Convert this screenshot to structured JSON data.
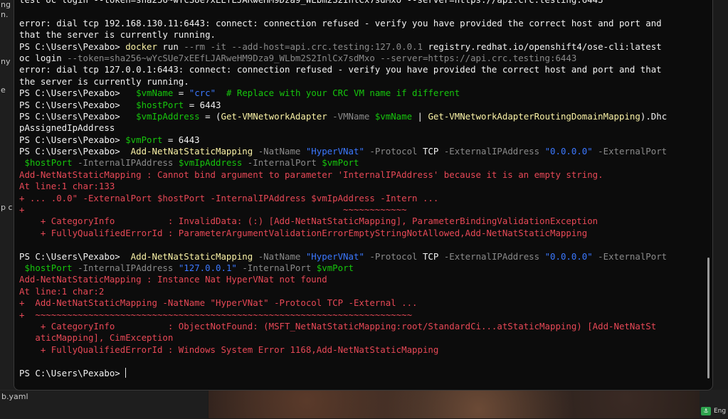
{
  "background": {
    "left_fragments": [
      "ng",
      "n.",
      "ny",
      "e",
      "p c"
    ],
    "bottom_left_text": "b.yaml"
  },
  "tray": {
    "app_icon": "docker-icon",
    "language": "Eng"
  },
  "terminal": {
    "lines": [
      [
        {
          "t": "test oc login --token=sha256~wYcSUe7xEEfLJARweHM9Dza9_WLbm2S2InlCx7sdMxo --server=https://api.crc.testing:6443",
          "c": "wh"
        }
      ],
      [],
      [
        {
          "t": "error: dial tcp 192.168.130.11:6443: connect: connection refused - verify you have provided the correct host and port and",
          "c": "wh"
        }
      ],
      [
        {
          "t": "that the server is currently running.",
          "c": "wh"
        }
      ],
      [
        {
          "t": "PS C:\\Users\\Pexabo> ",
          "c": "wh"
        },
        {
          "t": "docker",
          "c": "y"
        },
        {
          "t": " run ",
          "c": "wh"
        },
        {
          "t": "--rm -it --add-host=api.crc.testing:127.0.0.1",
          "c": "gy"
        },
        {
          "t": " registry.redhat.io/openshift4/ose-cli:latest",
          "c": "wh"
        }
      ],
      [
        {
          "t": "oc login ",
          "c": "wh"
        },
        {
          "t": "--token=sha256~wYcSUe7xEEfLJARweHM9Dza9_WLbm2S2InlCx7sdMxo --server=https://api.crc.testing:6443",
          "c": "gy"
        }
      ],
      [
        {
          "t": "error: dial tcp 127.0.0.1:6443: connect: connection refused - verify you have provided the correct host and port and that",
          "c": "wh"
        }
      ],
      [
        {
          "t": "the server is currently running.",
          "c": "wh"
        }
      ],
      [
        {
          "t": "PS C:\\Users\\Pexabo>   ",
          "c": "wh"
        },
        {
          "t": "$vmName",
          "c": "gr"
        },
        {
          "t": " = ",
          "c": "wh"
        },
        {
          "t": "\"crc\"",
          "c": "bl"
        },
        {
          "t": "  # Replace with your CRC VM name if different",
          "c": "gr"
        }
      ],
      [
        {
          "t": "PS C:\\Users\\Pexabo>   ",
          "c": "wh"
        },
        {
          "t": "$hostPort",
          "c": "gr"
        },
        {
          "t": " = 6443",
          "c": "wh"
        }
      ],
      [
        {
          "t": "PS C:\\Users\\Pexabo>   ",
          "c": "wh"
        },
        {
          "t": "$vmIpAddress",
          "c": "gr"
        },
        {
          "t": " = (",
          "c": "wh"
        },
        {
          "t": "Get-VMNetworkAdapter",
          "c": "y"
        },
        {
          "t": " -VMName ",
          "c": "gy"
        },
        {
          "t": "$vmName",
          "c": "gr"
        },
        {
          "t": " | ",
          "c": "wh"
        },
        {
          "t": "Get-VMNetworkAdapterRoutingDomainMapping",
          "c": "y"
        },
        {
          "t": ").Dhc",
          "c": "wh"
        }
      ],
      [
        {
          "t": "pAssignedIpAddress",
          "c": "wh"
        }
      ],
      [
        {
          "t": "PS C:\\Users\\Pexabo> ",
          "c": "wh"
        },
        {
          "t": "$vmPort",
          "c": "gr"
        },
        {
          "t": " = 6443",
          "c": "wh"
        }
      ],
      [
        {
          "t": "PS C:\\Users\\Pexabo>  ",
          "c": "wh"
        },
        {
          "t": "Add-NetNatStaticMapping",
          "c": "y"
        },
        {
          "t": " -NatName ",
          "c": "gy"
        },
        {
          "t": "\"HyperVNat\"",
          "c": "bl"
        },
        {
          "t": " -Protocol ",
          "c": "gy"
        },
        {
          "t": "TCP",
          "c": "wh"
        },
        {
          "t": " -ExternalIPAddress ",
          "c": "gy"
        },
        {
          "t": "\"0.0.0.0\"",
          "c": "bl"
        },
        {
          "t": " -ExternalPort",
          "c": "gy"
        }
      ],
      [
        {
          "t": " $hostPort",
          "c": "gr"
        },
        {
          "t": " -InternalIPAddress ",
          "c": "gy"
        },
        {
          "t": "$vmIpAddress",
          "c": "gr"
        },
        {
          "t": " -InternalPort ",
          "c": "gy"
        },
        {
          "t": "$vmPort",
          "c": "gr"
        }
      ],
      [
        {
          "t": "Add-NetNatStaticMapping : Cannot bind argument to parameter 'InternalIPAddress' because it is an empty string.",
          "c": "rd"
        }
      ],
      [
        {
          "t": "At line:1 char:133",
          "c": "rd"
        }
      ],
      [
        {
          "t": "+ ... .0.0\" -ExternalPort $hostPort -InternalIPAddress $vmIpAddress -Intern ...",
          "c": "rd"
        }
      ],
      [
        {
          "t": "+                                                            ~~~~~~~~~~~~",
          "c": "rd"
        }
      ],
      [
        {
          "t": "    + CategoryInfo          : InvalidData: (:) [Add-NetNatStaticMapping], ParameterBindingValidationException",
          "c": "rd"
        }
      ],
      [
        {
          "t": "    + FullyQualifiedErrorId : ParameterArgumentValidationErrorEmptyStringNotAllowed,Add-NetNatStaticMapping",
          "c": "rd"
        }
      ],
      [],
      [
        {
          "t": "PS C:\\Users\\Pexabo>  ",
          "c": "wh"
        },
        {
          "t": "Add-NetNatStaticMapping",
          "c": "y"
        },
        {
          "t": " -NatName ",
          "c": "gy"
        },
        {
          "t": "\"HyperVNat\"",
          "c": "bl"
        },
        {
          "t": " -Protocol ",
          "c": "gy"
        },
        {
          "t": "TCP",
          "c": "wh"
        },
        {
          "t": " -ExternalIPAddress ",
          "c": "gy"
        },
        {
          "t": "\"0.0.0.0\"",
          "c": "bl"
        },
        {
          "t": " -ExternalPort",
          "c": "gy"
        }
      ],
      [
        {
          "t": " $hostPort",
          "c": "gr"
        },
        {
          "t": " -InternalIPAddress ",
          "c": "gy"
        },
        {
          "t": "\"127.0.0.1\"",
          "c": "bl"
        },
        {
          "t": " -InternalPort ",
          "c": "gy"
        },
        {
          "t": "$vmPort",
          "c": "gr"
        }
      ],
      [
        {
          "t": "Add-NetNatStaticMapping : Instance Nat HyperVNat not found",
          "c": "rd"
        }
      ],
      [
        {
          "t": "At line:1 char:2",
          "c": "rd"
        }
      ],
      [
        {
          "t": "+  Add-NetNatStaticMapping -NatName \"HyperVNat\" -Protocol TCP -External ...",
          "c": "rd"
        }
      ],
      [
        {
          "t": "+  ~~~~~~~~~~~~~~~~~~~~~~~~~~~~~~~~~~~~~~~~~~~~~~~~~~~~~~~~~~~~~~~~~~~~~~~",
          "c": "rd"
        }
      ],
      [
        {
          "t": "    + CategoryInfo          : ObjectNotFound: (MSFT_NetNatStaticMapping:root/StandardCi...atStaticMapping) [Add-NetNatSt",
          "c": "rd"
        }
      ],
      [
        {
          "t": "   aticMapping], CimException",
          "c": "rd"
        }
      ],
      [
        {
          "t": "    + FullyQualifiedErrorId : Windows System Error 1168,Add-NetNatStaticMapping",
          "c": "rd"
        }
      ],
      [],
      [
        {
          "t": "PS C:\\Users\\Pexabo> ",
          "c": "wh"
        }
      ]
    ]
  }
}
